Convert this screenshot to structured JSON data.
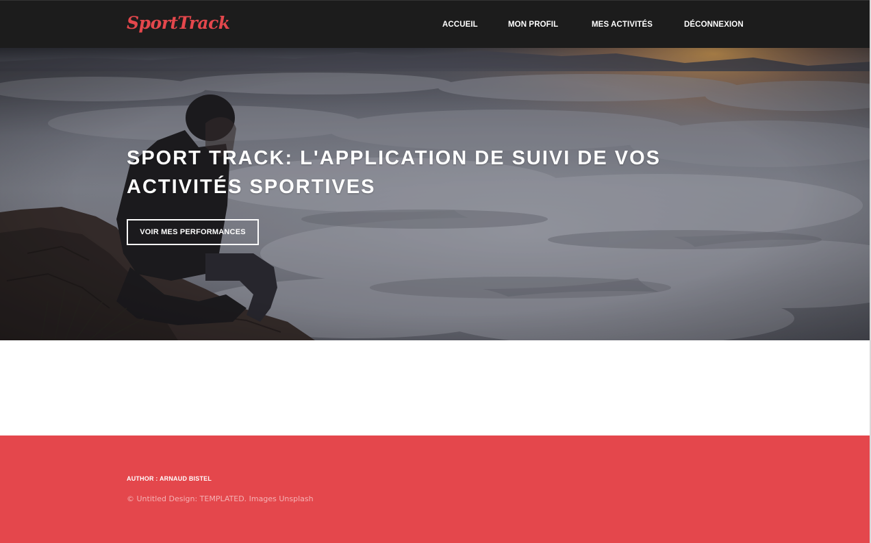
{
  "header": {
    "logo": "SportTrack",
    "nav": [
      {
        "label": "ACCUEIL"
      },
      {
        "label": "MON PROFIL"
      },
      {
        "label": "MES ACTIVITÉS"
      },
      {
        "label": "DÉCONNEXION"
      }
    ]
  },
  "hero": {
    "title_strong": "SPORT TRACK:",
    "title_rest": " L'APPLICATION DE SUIVI DE VOS ACTIVITÉS SPORTIVES",
    "button_label": "VOIR MES PERFORMANCES"
  },
  "footer": {
    "author": "AUTHOR : ARNAUD BISTEL",
    "copyright": "© Untitled Design: TEMPLATED. Images Unsplash"
  },
  "colors": {
    "header_bg": "#1c1c1c",
    "brand_red": "#e4474c",
    "white": "#ffffff"
  }
}
